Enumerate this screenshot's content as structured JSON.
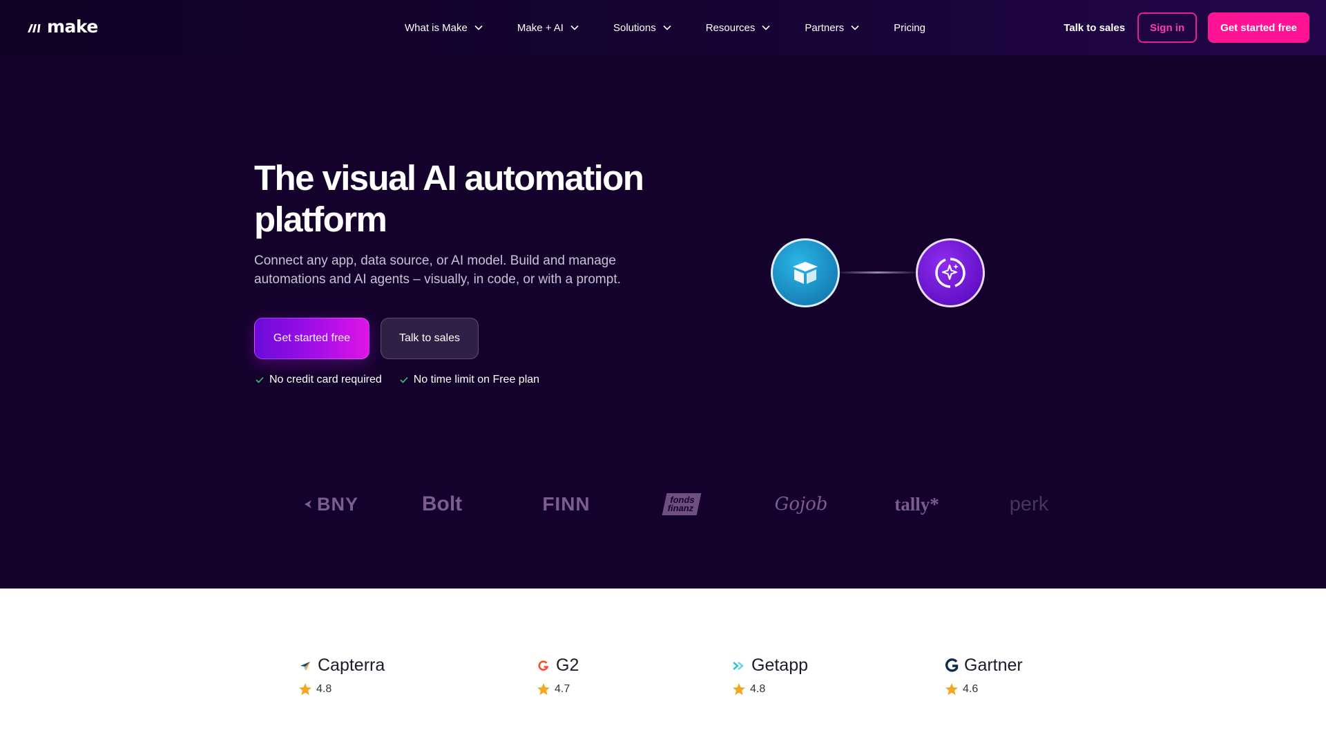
{
  "brand": {
    "name": "make"
  },
  "nav": {
    "items": [
      {
        "label": "What is Make",
        "has_dropdown": true
      },
      {
        "label": "Make + AI",
        "has_dropdown": true
      },
      {
        "label": "Solutions",
        "has_dropdown": true
      },
      {
        "label": "Resources",
        "has_dropdown": true
      },
      {
        "label": "Partners",
        "has_dropdown": true
      },
      {
        "label": "Pricing",
        "has_dropdown": false
      }
    ]
  },
  "header_actions": {
    "talk_to_sales": "Talk to sales",
    "sign_in": "Sign in",
    "get_started": "Get started free"
  },
  "hero": {
    "title": "The visual AI automation platform",
    "subtitle": "Connect any app, data source, or AI model. Build and manage automations and AI agents – visually, in code, or with a prompt.",
    "primary_cta": "Get started free",
    "secondary_cta": "Talk to sales",
    "perks": [
      "No credit card required",
      "No time limit on Free plan"
    ]
  },
  "scenario": {
    "nodes": [
      "airtable-icon",
      "ai-agent-icon"
    ]
  },
  "customer_logos": {
    "bny": "BNY",
    "bolt": "Bolt",
    "finn": "FINN",
    "fonds_line1": "fonds",
    "fonds_line2": "finanz",
    "gojob": "Gojob",
    "tally": "tally*",
    "perk": "perk"
  },
  "ratings": [
    {
      "name": "Capterra",
      "score": "4.8",
      "icon": "capterra-icon"
    },
    {
      "name": "G2",
      "score": "4.7",
      "icon": "g2-icon"
    },
    {
      "name": "Getapp",
      "score": "4.8",
      "icon": "getapp-icon"
    },
    {
      "name": "Gartner",
      "score": "4.6",
      "icon": "gartner-icon"
    }
  ],
  "colors": {
    "hero_bg": "#15022c",
    "accent_pink": "#ff1493",
    "accent_purple": "#6a0bd9",
    "star": "#f5a623"
  }
}
